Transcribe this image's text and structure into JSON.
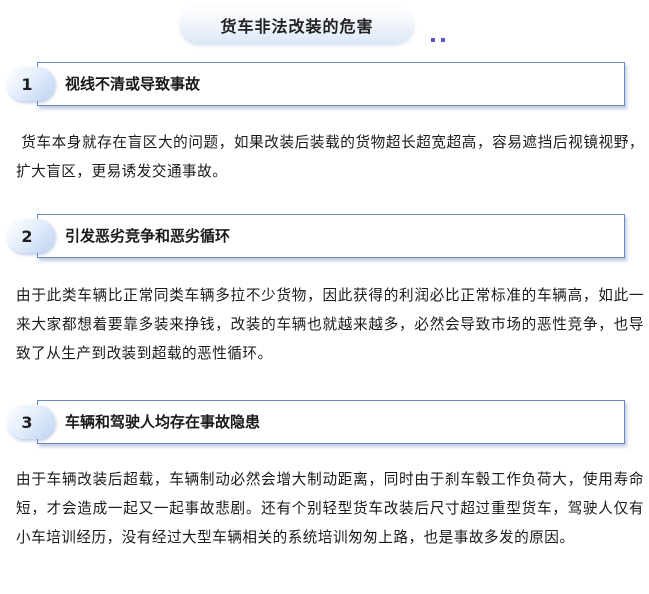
{
  "title": "货车非法改装的危害",
  "sections": [
    {
      "number": "1",
      "heading": "视线不清或导致事故",
      "body": " 货车本身就存在盲区大的问题，如果改装后装载的货物超长超宽超高，容易遮挡后视镜视野，扩大盲区，更易诱发交通事故。"
    },
    {
      "number": "2",
      "heading": "引发恶劣竞争和恶劣循环",
      "body": "由于此类车辆比正常同类车辆多拉不少货物，因此获得的利润必比正常标准的车辆高，如此一来大家都想着要靠多装来挣钱，改装的车辆也就越来越多，必然会导致市场的恶性竞争，也导致了从生产到改装到超载的恶性循环。"
    },
    {
      "number": "3",
      "heading": "车辆和驾驶人均存在事故隐患",
      "body": "由于车辆改装后超载，车辆制动必然会增大制动距离，同时由于刹车毂工作负荷大，使用寿命短，才会造成一起又一起事故悲剧。还有个别轻型货车改装后尺寸超过重型货车，驾驶人仅有小车培训经历，没有经过大型车辆相关的系统培训匆匆上路，也是事故多发的原因。"
    }
  ]
}
